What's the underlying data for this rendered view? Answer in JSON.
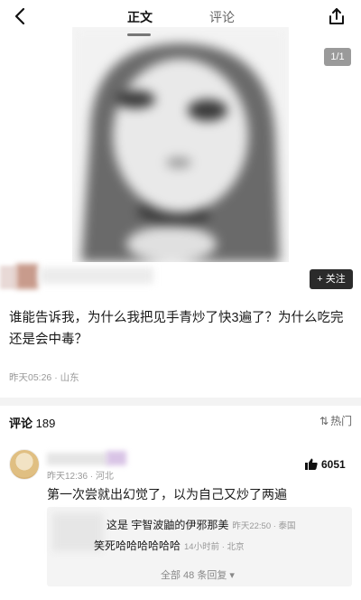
{
  "header": {
    "back_icon": "back-arrow-icon",
    "tab_main": "正文",
    "tab_comments": "评论",
    "share_icon": "share-icon"
  },
  "image": {
    "page_counter": "1/1"
  },
  "author": {
    "follow_label": "+ 关注"
  },
  "post": {
    "text": "谁能告诉我，为什么我把见手青炒了快3遍了？为什么吃完还是会中毒？",
    "meta": "昨天05:26 · 山东"
  },
  "comments": {
    "label": "评论",
    "count": "189",
    "sort_label": "热门",
    "sort_icon": "sort-icon",
    "items": [
      {
        "meta": "昨天12:36 · 河北",
        "likes": "6051",
        "like_icon": "thumbs-up-icon",
        "text": "第一次尝就出幻觉了，以为自己又炒了两遍",
        "replies": [
          {
            "text": "这是 宇智波鼬的伊邪那美",
            "meta": "昨天22:50 · 泰国"
          },
          {
            "text": "笑死哈哈哈哈哈哈",
            "meta": "14小时前 · 北京"
          }
        ],
        "view_all": "全部 48 条回复"
      }
    ]
  },
  "colors": {
    "follow_bg": "#2b2b2b",
    "meta_text": "#999999",
    "divider": "#f3f3f3"
  }
}
